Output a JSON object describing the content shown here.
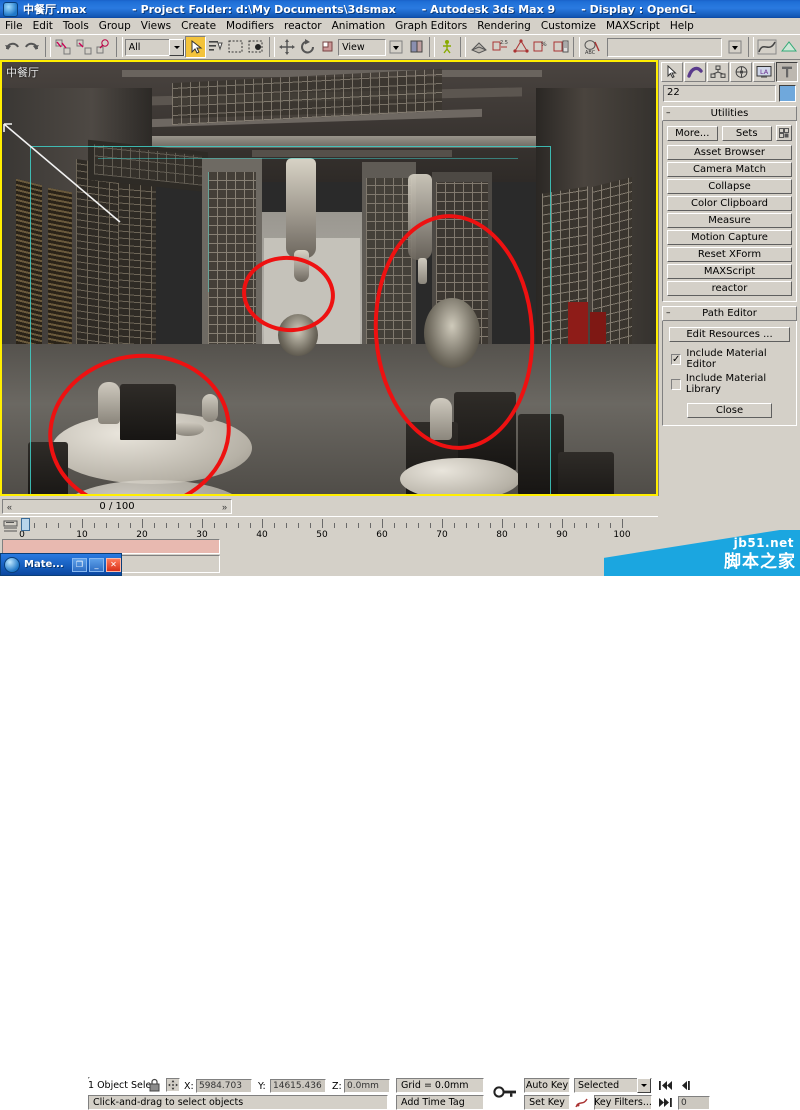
{
  "titlebar": {
    "file": "中餐厅.max",
    "project": "- Project Folder: d:\\My Documents\\3dsmax",
    "app": "- Autodesk 3ds Max 9",
    "display": "- Display : OpenGL"
  },
  "menu": {
    "items": [
      {
        "label": "File"
      },
      {
        "label": "Edit"
      },
      {
        "label": "Tools"
      },
      {
        "label": "Group"
      },
      {
        "label": "Views"
      },
      {
        "label": "Create"
      },
      {
        "label": "Modifiers"
      },
      {
        "label": "reactor"
      },
      {
        "label": "Animation"
      },
      {
        "label": "Graph Editors"
      },
      {
        "label": "Rendering"
      },
      {
        "label": "Customize"
      },
      {
        "label": "MAXScript"
      },
      {
        "label": "Help"
      }
    ]
  },
  "toolbar": {
    "undo": "undo-icon",
    "redo": "redo-icon",
    "select_and_link": "select-and-link-icon",
    "unlink_selection": "unlink-selection-icon",
    "bind_to_space_warp": "bind-to-space-warp-icon",
    "selection_filter_value": "All",
    "select_object": "select-object-icon",
    "select_by_name": "select-by-name-icon",
    "rectangular_select_region": "rectangular-selection-region-icon",
    "window_crossing": "window-crossing-icon",
    "select_and_move": "select-and-move-icon",
    "select_and_rotate": "select-and-rotate-icon",
    "select_and_scale": "select-and-uniform-scale-icon",
    "reference_coord_value": "View",
    "use_pivot_center": "use-pivot-point-center-icon",
    "mirror": "mirror-icon",
    "align": "align-icon",
    "layer_manager": "layer-manager-icon",
    "curve_editor": "curve-editor-icon",
    "schematic_view": "schematic-view-icon",
    "material_editor": "material-editor-icon",
    "render_scene": "render-scene-dialog-icon",
    "render_type_value": "",
    "quick_render": "quick-render-icon",
    "render_last": "render-last-icon"
  },
  "viewport": {
    "label": "中餐厅",
    "shading": "Smooth + Highlights"
  },
  "command_panel": {
    "tabs": [
      {
        "name": "create",
        "icon": "create-arrow-icon",
        "selected": false
      },
      {
        "name": "modify",
        "icon": "modify-bent-tube-icon",
        "selected": false
      },
      {
        "name": "hierarchy",
        "icon": "hierarchy-icon",
        "selected": false
      },
      {
        "name": "motion",
        "icon": "motion-wheel-icon",
        "selected": false
      },
      {
        "name": "display",
        "icon": "display-monitor-icon",
        "selected": false
      },
      {
        "name": "utilities",
        "icon": "utilities-hammer-icon",
        "selected": true
      }
    ],
    "object_name": "22",
    "object_color": "#6fa8dc",
    "utilities_rollout": {
      "title": "Utilities",
      "more": "More...",
      "sets": "Sets",
      "config_icon": "configure-button-sets-icon",
      "buttons": [
        "Asset Browser",
        "Camera Match",
        "Collapse",
        "Color Clipboard",
        "Measure",
        "Motion Capture",
        "Reset XForm",
        "MAXScript",
        "reactor"
      ]
    },
    "path_editor_rollout": {
      "title": "Path Editor",
      "edit_resources": "Edit Resources ...",
      "include_material_editor": {
        "label": "Include Material Editor",
        "checked": true
      },
      "include_material_library": {
        "label": "Include Material Library",
        "checked": false
      },
      "close": "Close"
    }
  },
  "timeline": {
    "current_frame_label": "0 / 100",
    "prev_arrow": "«",
    "next_arrow": "»",
    "ticks": [
      "0",
      "10",
      "20",
      "30",
      "40",
      "50",
      "60",
      "70",
      "80",
      "90",
      "100"
    ],
    "open_mini_curve_editor": "open-mini-curve-editor-icon"
  },
  "status": {
    "selection_text": "1 Object Sele",
    "lock_icon": "lock-selection-icon",
    "transform_icon": "absolute-relative-transform-toggle-icon",
    "x_label": "X:",
    "x_value": "5984.703",
    "y_label": "Y:",
    "y_value": "14615.436",
    "z_label": "Z:",
    "z_value": "0.0mm",
    "grid": "Grid = 0.0mm",
    "add_time_tag": "Add Time Tag",
    "prompt": "Click-and-drag to select objects",
    "key_mode_icon": "key-mode-toggle-icon",
    "auto_key": "Auto Key",
    "set_key": "Set Key",
    "key_filter_set": "Selected",
    "set_key_icon": "set-key-icon",
    "key_filters": "Key Filters...",
    "go_to_start": "go-to-start-icon",
    "prev_frame": "previous-frame-icon",
    "go_to_end": "go-to-end-icon",
    "frame_field": "0"
  },
  "material_editor_task": {
    "icon": "material-editor-icon",
    "title": "Mate...",
    "restore": "restore-window-icon",
    "minimize": "minimize-window-icon",
    "close": "close-window-icon"
  },
  "watermark": {
    "line1": "jb51.net",
    "line2": "脚本之家"
  }
}
